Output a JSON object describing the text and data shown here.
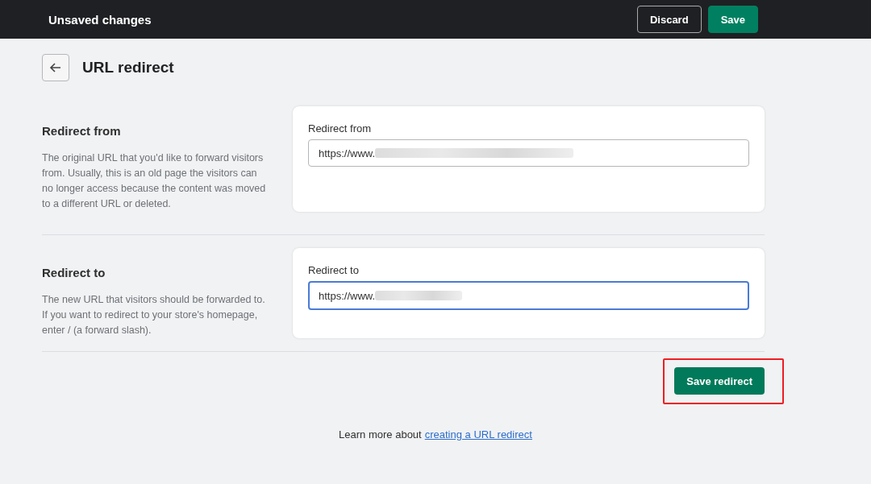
{
  "top_bar": {
    "title": "Unsaved changes",
    "buttons": [
      {
        "label": "Discard",
        "kind": "secondary"
      },
      {
        "label": "Save",
        "kind": "primary"
      }
    ]
  },
  "page": {
    "title": "URL redirect"
  },
  "sections": [
    {
      "title": "Redirect from",
      "description": "The original URL that you'd like to forward visitors from. Usually, this is an old page the visitors can no longer access because the content was moved to a different URL or deleted.",
      "field": {
        "label": "Redirect from",
        "value": "https://www.",
        "focused": false
      }
    },
    {
      "title": "Redirect to",
      "description": "The new URL that visitors should be forwarded to. If you want to redirect to your store's homepage, enter / (a forward slash).",
      "field": {
        "label": "Redirect to",
        "value": "https://www.",
        "focused": true
      }
    }
  ],
  "save_button": {
    "label": "Save redirect",
    "highlighted": true
  },
  "footer": {
    "text": "Learn more about",
    "link": "creating a URL redirect"
  }
}
